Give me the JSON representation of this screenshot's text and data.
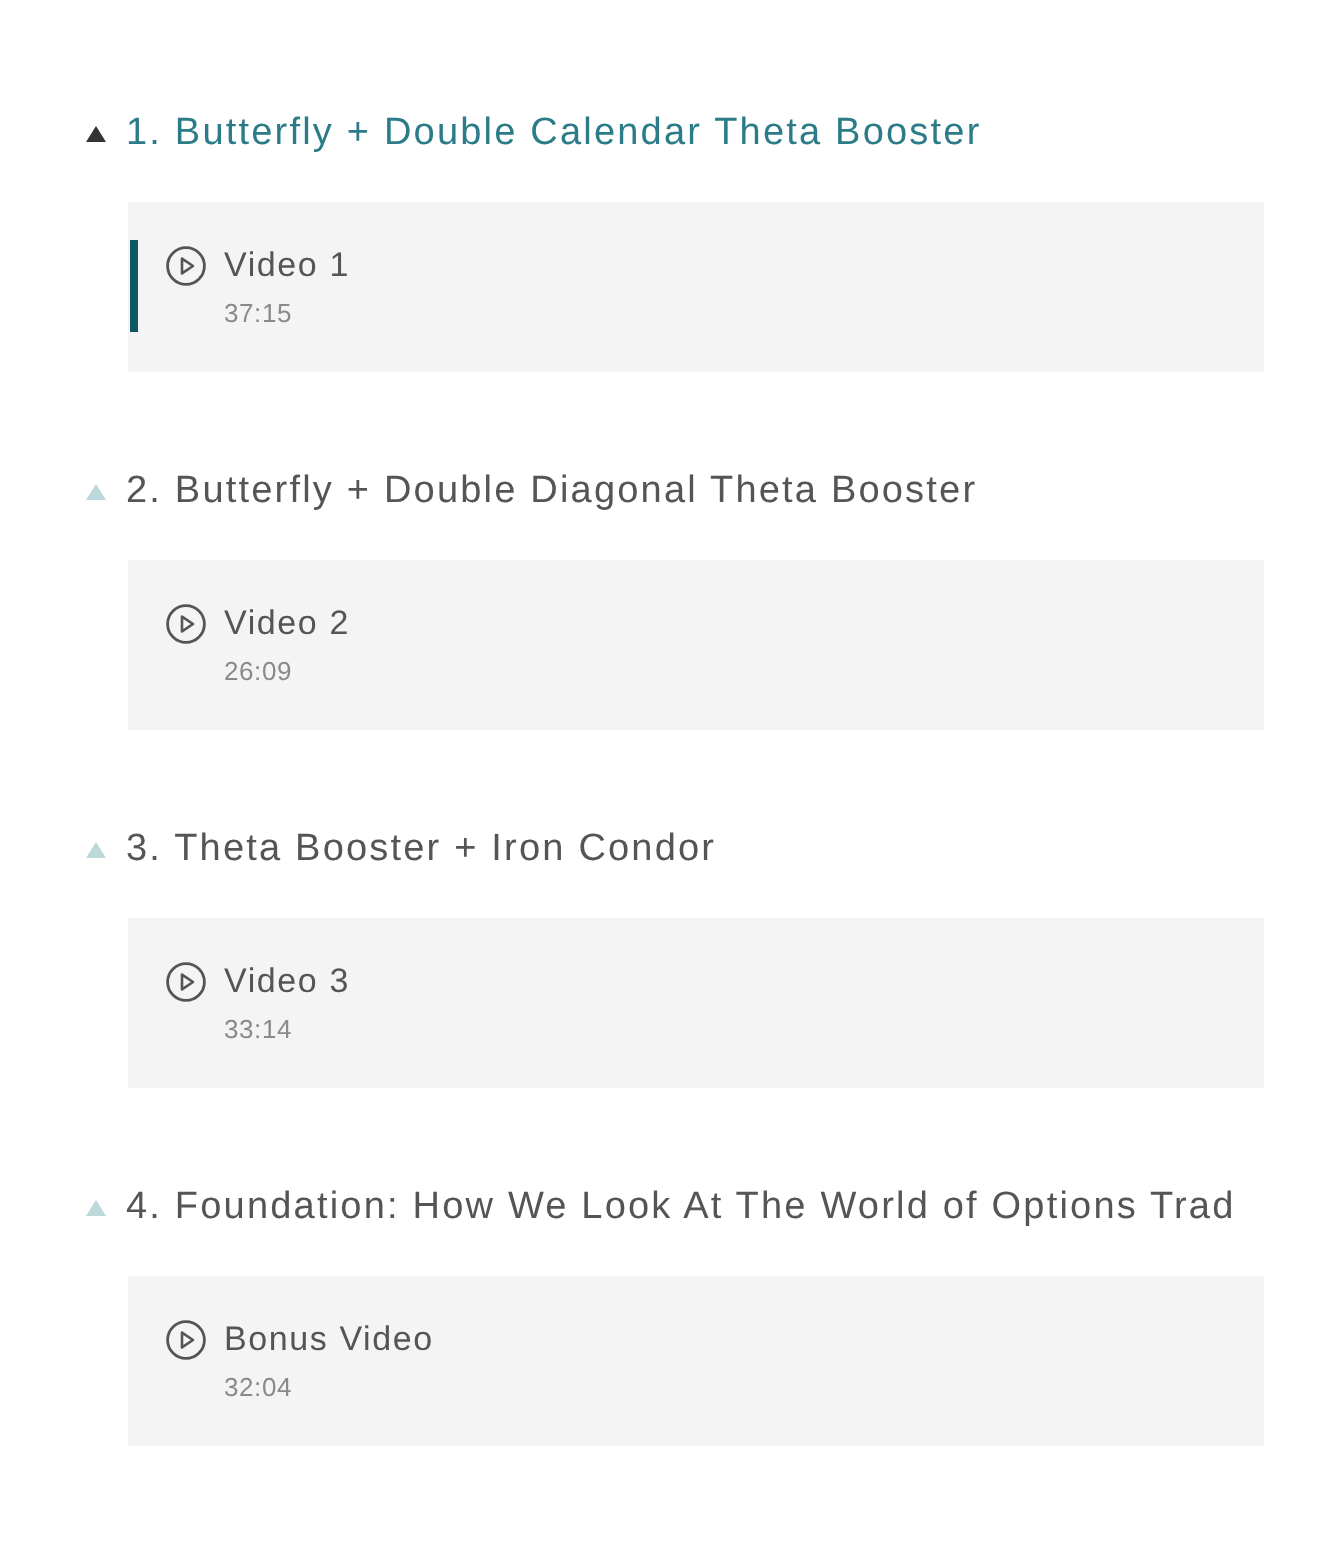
{
  "sections": [
    {
      "title": "1. Butterfly + Double Calendar Theta Booster",
      "selected": true,
      "expanded": true,
      "lessons": [
        {
          "title": "Video 1",
          "duration": "37:15",
          "selected": true
        }
      ]
    },
    {
      "title": "2. Butterfly + Double Diagonal Theta Booster",
      "selected": false,
      "expanded": true,
      "lessons": [
        {
          "title": "Video 2",
          "duration": "26:09",
          "selected": false
        }
      ]
    },
    {
      "title": "3. Theta Booster + Iron Condor",
      "selected": false,
      "expanded": true,
      "lessons": [
        {
          "title": "Video 3",
          "duration": "33:14",
          "selected": false
        }
      ]
    },
    {
      "title": "4. Foundation: How We Look At The World of Options Trad",
      "selected": false,
      "expanded": true,
      "lessons": [
        {
          "title": "Bonus Video",
          "duration": "32:04",
          "selected": false
        }
      ]
    }
  ]
}
